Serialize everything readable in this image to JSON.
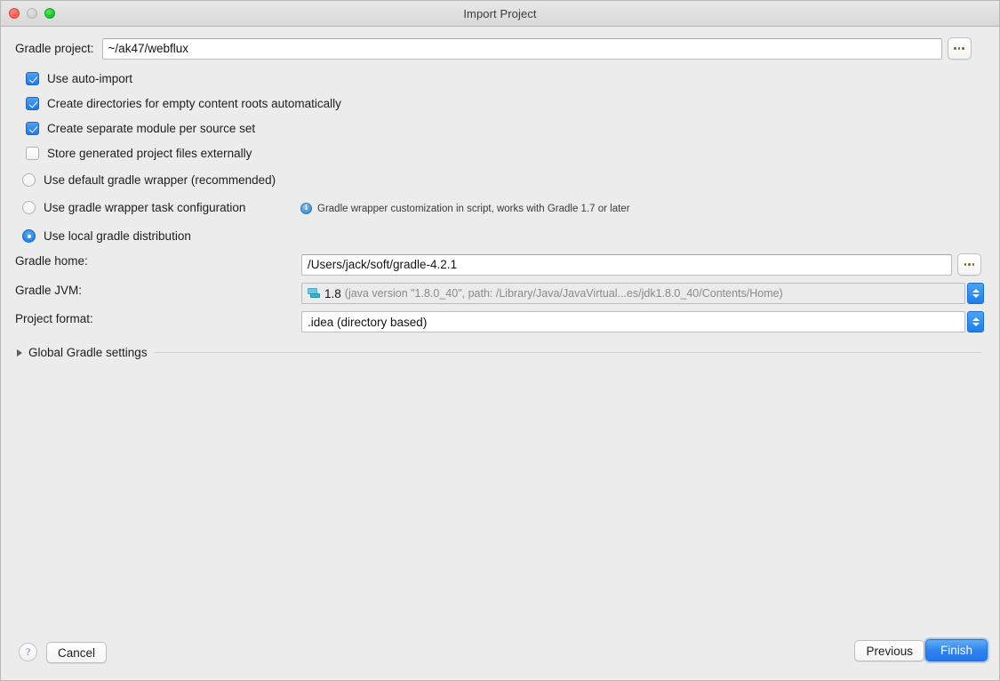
{
  "window": {
    "title": "Import Project",
    "traffic_lights": [
      "close-button",
      "minimize-button",
      "zoom-button"
    ]
  },
  "form": {
    "gradle_project": {
      "label": "Gradle project:",
      "value": "~/ak47/webflux",
      "browse_label": "..."
    },
    "checkboxes": [
      {
        "label": "Use auto-import",
        "checked": true
      },
      {
        "label": "Create directories for empty content roots automatically",
        "checked": true
      },
      {
        "label": "Create separate module per source set",
        "checked": true
      },
      {
        "label": "Store generated project files externally",
        "checked": false
      }
    ],
    "radios": [
      {
        "label": "Use default gradle wrapper (recommended)",
        "selected": false
      },
      {
        "label": "Use gradle wrapper task configuration",
        "selected": false
      },
      {
        "label": "Use local gradle distribution",
        "selected": true
      }
    ],
    "wrapper_hint": "Gradle wrapper customization in script, works with Gradle 1.7 or later",
    "gradle_home": {
      "label": "Gradle home:",
      "value": "/Users/jack/soft/gradle-4.2.1",
      "browse_label": "..."
    },
    "gradle_jvm": {
      "label": "Gradle JVM:",
      "version": "1.8",
      "detail": "(java version \"1.8.0_40\", path: /Library/Java/JavaVirtual...es/jdk1.8.0_40/Contents/Home)"
    },
    "project_format": {
      "label": "Project format:",
      "value": ".idea (directory based)"
    },
    "global_settings": {
      "label": "Global Gradle settings",
      "expanded": false
    }
  },
  "footer": {
    "help_label": "?",
    "cancel_label": "Cancel",
    "previous_label": "Previous",
    "finish_label": "Finish"
  },
  "colors": {
    "window_background": "#ececec",
    "accent_blue": "#1a7ced",
    "field_background": "#ffffff",
    "disabled_field": "#ebebeb"
  }
}
